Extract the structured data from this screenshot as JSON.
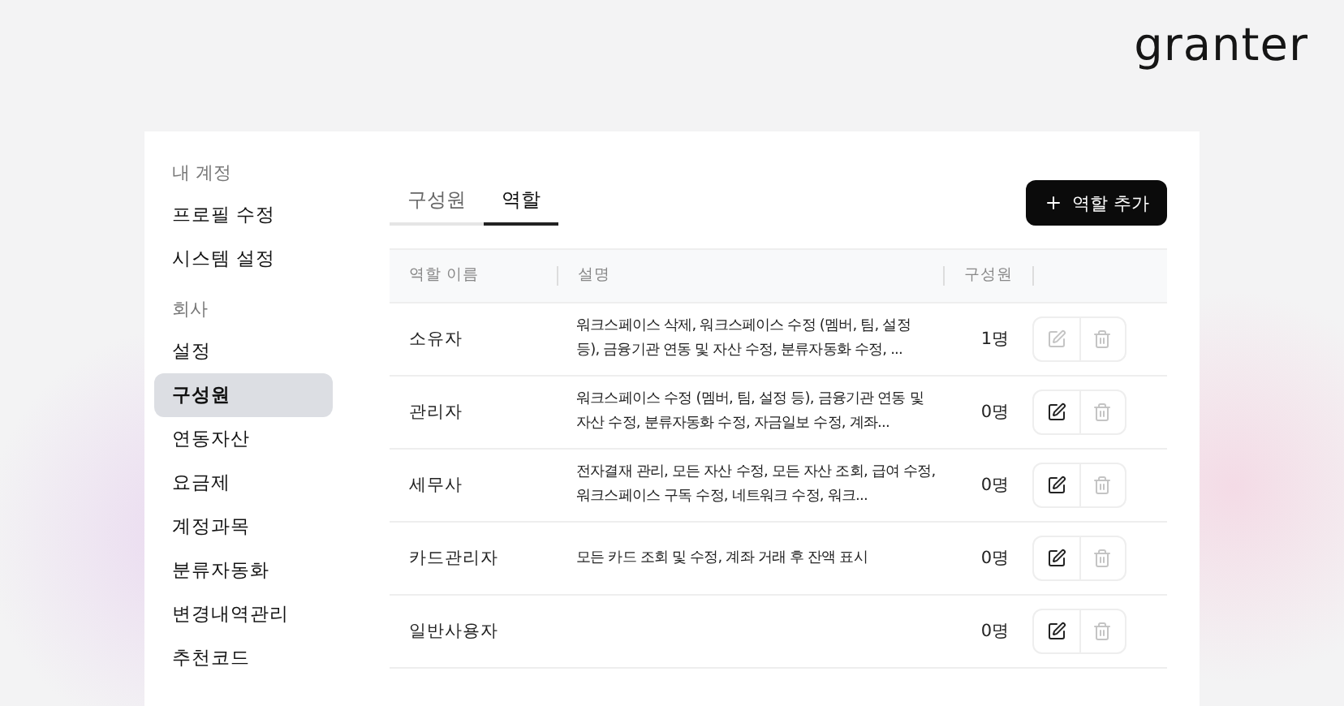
{
  "logo": "granter",
  "sidebar": {
    "sections": [
      {
        "title": "내 계정",
        "items": [
          {
            "label": "프로필 수정",
            "selected": false
          },
          {
            "label": "시스템 설정",
            "selected": false
          }
        ]
      },
      {
        "title": "회사",
        "items": [
          {
            "label": "설정",
            "selected": false
          },
          {
            "label": "구성원",
            "selected": true
          },
          {
            "label": "연동자산",
            "selected": false
          },
          {
            "label": "요금제",
            "selected": false
          },
          {
            "label": "계정과목",
            "selected": false
          },
          {
            "label": "분류자동화",
            "selected": false
          },
          {
            "label": "변경내역관리",
            "selected": false
          },
          {
            "label": "추천코드",
            "selected": false
          }
        ]
      }
    ]
  },
  "tabs": [
    {
      "label": "구성원",
      "selected": false
    },
    {
      "label": "역할",
      "selected": true
    }
  ],
  "add_button": {
    "label": "역할 추가"
  },
  "table": {
    "columns": [
      "역할 이름",
      "설명",
      "구성원"
    ],
    "rows": [
      {
        "name": "소유자",
        "description": "워크스페이스 삭제, 워크스페이스 수정 (멤버, 팀, 설정 등), 금융기관 연동 및 자산 수정, 분류자동화 수정, ...",
        "members": "1명",
        "edit_disabled": true,
        "delete_disabled": true
      },
      {
        "name": "관리자",
        "description": "워크스페이스 수정 (멤버, 팀, 설정 등), 금융기관 연동 및 자산 수정, 분류자동화 수정, 자금일보 수정, 계좌...",
        "members": "0명",
        "edit_disabled": false,
        "delete_disabled": true
      },
      {
        "name": "세무사",
        "description": "전자결재 관리, 모든 자산 수정, 모든 자산 조회, 급여 수정, 워크스페이스 구독 수정, 네트워크 수정, 워크...",
        "members": "0명",
        "edit_disabled": false,
        "delete_disabled": true
      },
      {
        "name": "카드관리자",
        "description": "모든 카드 조회 및 수정, 계좌 거래 후 잔액 표시",
        "members": "0명",
        "edit_disabled": false,
        "delete_disabled": true
      },
      {
        "name": "일반사용자",
        "members": "0명",
        "edit_disabled": false,
        "delete_disabled": true
      }
    ]
  }
}
